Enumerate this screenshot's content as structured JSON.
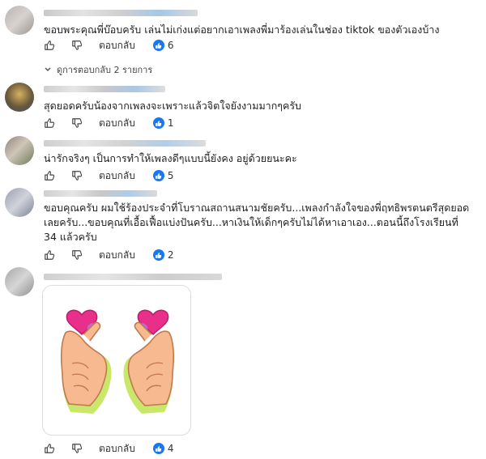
{
  "comments": [
    {
      "text": "ขอบพระคุณพี่บ๊อบครับ เล่นไม่เก่งแต่อยากเอาเพลงพี่มาร้องเล่นในช่อง tiktok ของตัวเองบ้าง",
      "reply_label": "ตอบกลับ",
      "likes": "6"
    },
    {
      "text": "สุดยอดครับน้องจากเพลงจะเพราะแล้วจิตใจยังงามมากๆครับ",
      "reply_label": "ตอบกลับ",
      "likes": "1"
    },
    {
      "text": "น่ารักจริงๆ เป็นการทำให้เพลงดีๆแบบนี้ยังคง อยู่ด้วยยนะคะ",
      "reply_label": "ตอบกลับ",
      "likes": "5"
    },
    {
      "text_lines": [
        "ขอบคุณครับ ผมใช้ร้องประจำที่โบราณสถานสนามชัยครับ...เพลงกำลังใจของพี่ฤทธิพรตนตรีสุดยอด",
        "เลยครับ...ขอบคุณที่เอื้อเฟื้อแบ่งปันครับ...หาเงินให้เด็กๆครับไม่ได้หาเอาเอง...ตอนนี้ถึงโรงเรียนที่",
        "34 แล้วครับ"
      ],
      "reply_label": "ตอบกลับ",
      "likes": "2"
    },
    {
      "sticker": "heart-hands",
      "reply_label": "ตอบกลับ",
      "likes": "4"
    }
  ],
  "view_replies": "ดูการตอบกลับ 2 รายการ",
  "colors": {
    "accent": "#1877f2",
    "heart": "#e8308a",
    "skin": "#f7b98f",
    "glow": "#c9e86a"
  },
  "icons": [
    "thumbs-up-icon",
    "thumbs-down-icon",
    "like-badge-icon",
    "chevron-down-icon"
  ]
}
